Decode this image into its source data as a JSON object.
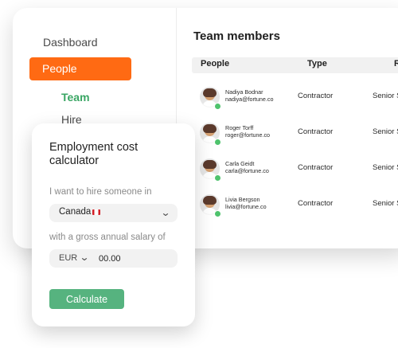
{
  "sidebar": {
    "items": [
      {
        "label": "Dashboard"
      },
      {
        "label": "People"
      },
      {
        "label": "Team"
      },
      {
        "label": "Hire"
      }
    ]
  },
  "team_panel": {
    "title": "Team members",
    "columns": [
      "People",
      "Type",
      "R"
    ],
    "members": [
      {
        "name": "Nadiya Bodnar",
        "email": "nadiya@fortune.co",
        "type": "Contractor",
        "role": "Senior Soft"
      },
      {
        "name": "Roger Torff",
        "email": "roger@fortune.co",
        "type": "Contractor",
        "role": "Senior Soft"
      },
      {
        "name": "Carla Geidt",
        "email": "carla@fortune.co",
        "type": "Contractor",
        "role": "Senior Soft"
      },
      {
        "name": "Livia Bergson",
        "email": "livia@fortune.co",
        "type": "Contractor",
        "role": "Senior Soft"
      }
    ]
  },
  "calculator": {
    "title": "Employment cost calculator",
    "hire_label": "I want to hire someone in",
    "country_value": "Canada",
    "country_flag_icon": "canada-flag-icon",
    "salary_label": "with a gross annual salary of",
    "currency": "EUR",
    "salary_value": "00.00",
    "button_label": "Calculate"
  },
  "colors": {
    "accent": "#ff6a13",
    "active_nav": "#3aa664",
    "button": "#56b37f",
    "status": "#4fc36d"
  }
}
